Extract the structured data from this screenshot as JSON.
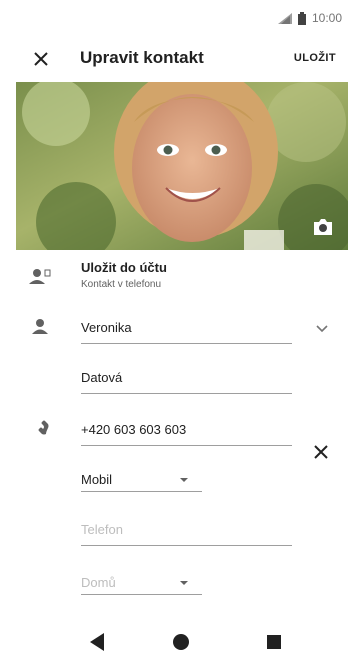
{
  "status_bar": {
    "time": "10:00"
  },
  "app_bar": {
    "title": "Upravit kontakt",
    "save_label": "ULOŽIT"
  },
  "account": {
    "title": "Uložit do účtu",
    "subtitle": "Kontakt v telefonu"
  },
  "name": {
    "first": "Veronika",
    "last": "Datová"
  },
  "phone": {
    "number": "+420 603 603 603",
    "type": "Mobil",
    "next_placeholder": "Telefon",
    "next_type_placeholder": "Domů"
  },
  "colors": {
    "text": "#212121",
    "secondary": "#616161",
    "divider": "#9e9e9e",
    "placeholder": "#bdbdbd"
  }
}
